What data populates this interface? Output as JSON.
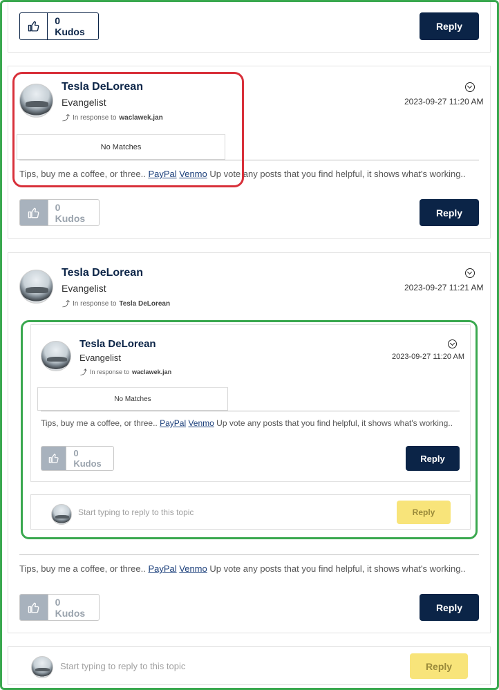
{
  "kudos_label": "0 Kudos",
  "reply_label": "Reply",
  "post1": {
    "author": "Tesla DeLorean",
    "rank": "Evangelist",
    "in_response_prefix": "In response to",
    "in_response_to": "waclawek.jan",
    "date": "2023-09-27 11:20 AM",
    "no_matches": "No Matches"
  },
  "post2": {
    "author": "Tesla DeLorean",
    "rank": "Evangelist",
    "in_response_prefix": "In response to",
    "in_response_to": "Tesla DeLorean",
    "date": "2023-09-27 11:21 AM"
  },
  "quoted": {
    "author": "Tesla DeLorean",
    "rank": "Evangelist",
    "in_response_prefix": "In response to",
    "in_response_to": "waclawek.jan",
    "date": "2023-09-27 11:20 AM",
    "no_matches": "No Matches"
  },
  "signature": {
    "prefix": "Tips, buy me a coffee, or three.. ",
    "link1": "PayPal",
    "link2": "Venmo",
    "suffix": " Up vote any posts that you find helpful, it shows what's working.."
  },
  "reply_box": {
    "placeholder": "Start typing to reply to this topic",
    "button": "Reply"
  },
  "colors": {
    "brand_navy": "#0b2447",
    "highlight_red": "#d8303a",
    "highlight_green": "#3aa84f",
    "reply_yellow": "#f8e47a"
  }
}
